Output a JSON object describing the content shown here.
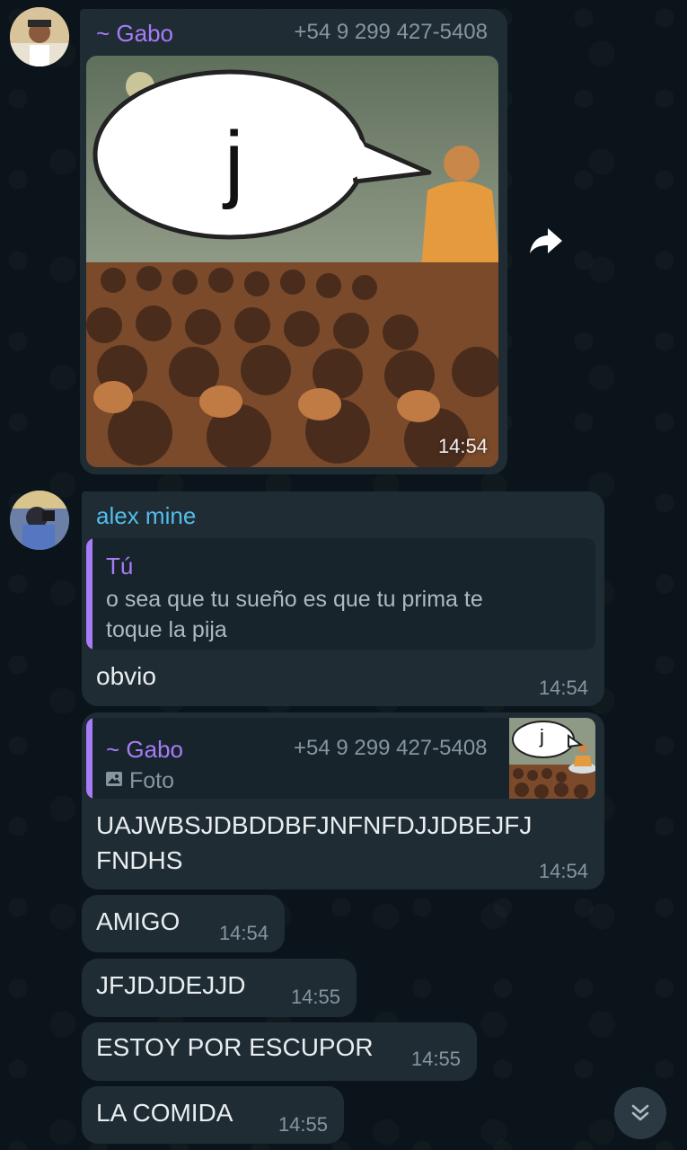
{
  "messages": [
    {
      "sender": "~ Gabo",
      "phone": "+54 9 299 427-5408",
      "media": "photo",
      "speech_text": "j",
      "time": "14:54"
    },
    {
      "sender": "alex mine",
      "reply": {
        "author": "Tú",
        "text_line1": "o sea que tu sueño es que tu prima te",
        "text_line2": "toque la pija"
      },
      "text": "obvio",
      "time": "14:54"
    },
    {
      "reply": {
        "author": "~ Gabo",
        "phone": "+54 9 299 427-5408",
        "type_label": "Foto",
        "thumb_text": "j"
      },
      "text_line1": "UAJWBSJDBDDBFJNFNFDJJDBEJFJ",
      "text_line2": "FNDHS",
      "time": "14:54"
    },
    {
      "text": "AMIGO",
      "time": "14:54"
    },
    {
      "text": "JFJDJDEJJD",
      "time": "14:55"
    },
    {
      "text": "ESTOY POR ESCUPOR",
      "time": "14:55"
    },
    {
      "text": "LA COMIDA",
      "time": "14:55"
    }
  ],
  "colors": {
    "background": "#0b141a",
    "bubble": "#1f2c34",
    "gabo_name": "#a77cf7",
    "alex_name": "#53bdeb",
    "reply_bar": "#a77cf7",
    "time": "#8696a0"
  },
  "icons": {
    "forward": "forward-arrow-icon",
    "scroll_down": "double-chevron-down-icon",
    "photo": "photo-icon"
  }
}
